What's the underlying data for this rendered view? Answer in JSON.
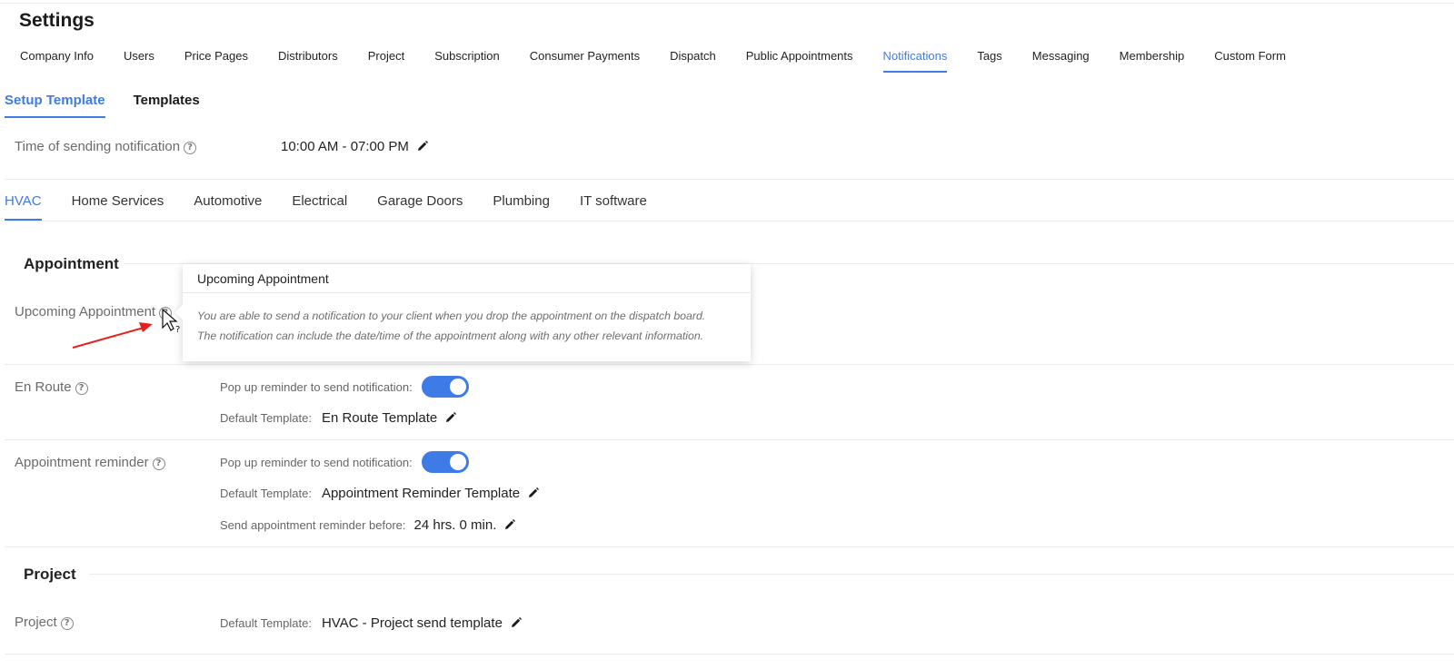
{
  "header": {
    "title": "Settings"
  },
  "main_tabs": [
    {
      "label": "Company Info",
      "active": false
    },
    {
      "label": "Users",
      "active": false
    },
    {
      "label": "Price Pages",
      "active": false
    },
    {
      "label": "Distributors",
      "active": false
    },
    {
      "label": "Project",
      "active": false
    },
    {
      "label": "Subscription",
      "active": false
    },
    {
      "label": "Consumer Payments",
      "active": false
    },
    {
      "label": "Dispatch",
      "active": false
    },
    {
      "label": "Public Appointments",
      "active": false
    },
    {
      "label": "Notifications",
      "active": true
    },
    {
      "label": "Tags",
      "active": false
    },
    {
      "label": "Messaging",
      "active": false
    },
    {
      "label": "Membership",
      "active": false
    },
    {
      "label": "Custom Form",
      "active": false
    }
  ],
  "sub_tabs": [
    {
      "label": "Setup Template",
      "active": true
    },
    {
      "label": "Templates",
      "active": false
    }
  ],
  "time_setting": {
    "label": "Time of sending notification",
    "value": "10:00 AM - 07:00 PM"
  },
  "industry_tabs": [
    {
      "label": "HVAC",
      "active": true
    },
    {
      "label": "Home Services",
      "active": false
    },
    {
      "label": "Automotive",
      "active": false
    },
    {
      "label": "Electrical",
      "active": false
    },
    {
      "label": "Garage Doors",
      "active": false
    },
    {
      "label": "Plumbing",
      "active": false
    },
    {
      "label": "IT software",
      "active": false
    }
  ],
  "appointment_section": {
    "title": "Appointment",
    "upcoming": {
      "label": "Upcoming Appointment"
    },
    "en_route": {
      "label": "En Route",
      "popup_label": "Pop up reminder to send notification:",
      "popup_on": true,
      "template_label": "Default Template:",
      "template_value": "En Route Template"
    },
    "reminder": {
      "label": "Appointment reminder",
      "popup_label": "Pop up reminder to send notification:",
      "popup_on": true,
      "template_label": "Default Template:",
      "template_value": "Appointment Reminder Template",
      "before_label": "Send appointment reminder before:",
      "before_value": "24 hrs. 0 min."
    }
  },
  "project_section": {
    "title": "Project",
    "project": {
      "label": "Project",
      "template_label": "Default Template:",
      "template_value": "HVAC - Project send template"
    }
  },
  "tooltip": {
    "title": "Upcoming Appointment",
    "line1": "You are able to send a notification to your client when you drop the appointment on the dispatch board.",
    "line2": "The notification can include the date/time of the appointment along with any other relevant information."
  },
  "colors": {
    "accent": "#3f7be6",
    "annotation_arrow": "#e8201c"
  }
}
